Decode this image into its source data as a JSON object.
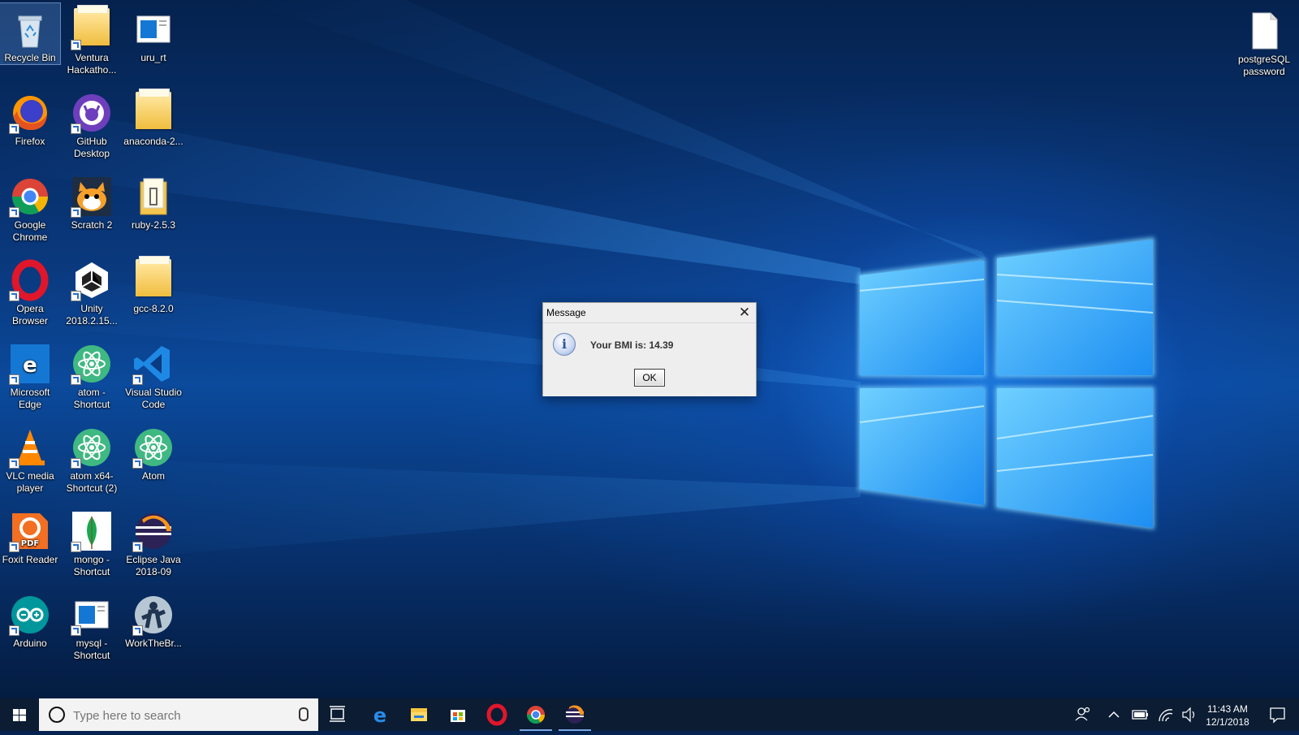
{
  "desktop": {
    "icons": [
      {
        "label": "Recycle Bin",
        "icon": "recycle-bin-icon"
      },
      {
        "label": "Ventura Hackatho...",
        "icon": "folder-icon"
      },
      {
        "label": "uru_rt",
        "icon": "window-app-icon"
      },
      {
        "label": "Firefox",
        "icon": "firefox-icon"
      },
      {
        "label": "GitHub Desktop",
        "icon": "github-icon"
      },
      {
        "label": "anaconda-2...",
        "icon": "folder-icon"
      },
      {
        "label": "Google Chrome",
        "icon": "chrome-icon"
      },
      {
        "label": "Scratch 2",
        "icon": "scratch-icon"
      },
      {
        "label": "ruby-2.5.3",
        "icon": "archive-folder-icon"
      },
      {
        "label": "Opera Browser",
        "icon": "opera-icon"
      },
      {
        "label": "Unity 2018.2.15...",
        "icon": "unity-icon"
      },
      {
        "label": "gcc-8.2.0",
        "icon": "folder-icon"
      },
      {
        "label": "Microsoft Edge",
        "icon": "edge-icon"
      },
      {
        "label": "atom - Shortcut",
        "icon": "atom-icon"
      },
      {
        "label": "Visual Studio Code",
        "icon": "vscode-icon"
      },
      {
        "label": "VLC media player",
        "icon": "vlc-icon"
      },
      {
        "label": "atom x64- Shortcut (2)",
        "icon": "atom-icon"
      },
      {
        "label": "Atom",
        "icon": "atom-icon"
      },
      {
        "label": "Foxit Reader",
        "icon": "foxit-pdf-icon"
      },
      {
        "label": "mongo - Shortcut",
        "icon": "mongodb-icon"
      },
      {
        "label": "Eclipse Java 2018-09",
        "icon": "eclipse-icon"
      },
      {
        "label": "Arduino",
        "icon": "arduino-icon"
      },
      {
        "label": "mysql - Shortcut",
        "icon": "window-app-icon"
      },
      {
        "label": "WorkTheBr...",
        "icon": "worker-icon"
      }
    ],
    "right_icon": {
      "label": "postgreSQL password",
      "icon": "text-document-icon"
    }
  },
  "dialog": {
    "title": "Message",
    "message": "Your BMI is: 14.39",
    "ok_label": "OK",
    "icon": "information-icon"
  },
  "taskbar": {
    "search_placeholder": "Type here to search",
    "pinned": [
      "task-view-icon",
      "edge-icon",
      "file-explorer-icon",
      "store-icon",
      "opera-icon",
      "chrome-icon",
      "eclipse-icon"
    ],
    "active_pinned": [
      "chrome-icon",
      "eclipse-icon"
    ],
    "tray": [
      "people-icon",
      "chevron-up-icon",
      "battery-icon",
      "wifi-icon",
      "volume-icon"
    ],
    "time": "11:43 AM",
    "date": "12/1/2018"
  },
  "colors": {
    "taskbar": "#0b1c33",
    "accent": "#0078d7",
    "wallpaper": "#0a3a80"
  }
}
